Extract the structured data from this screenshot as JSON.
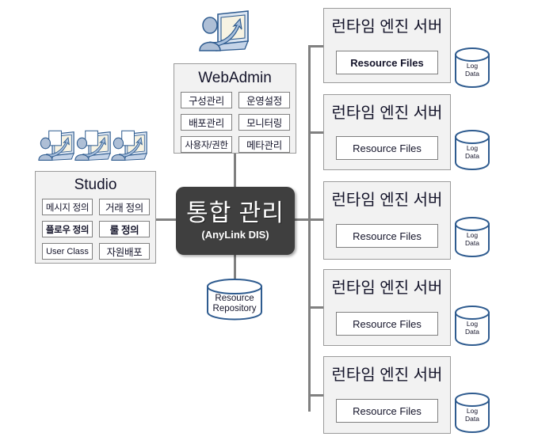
{
  "diagram": {
    "title": "AnyLink DIS architecture diagram",
    "colors": {
      "panel_fill": "#f2f2f2",
      "panel_border": "#9a9a9a",
      "connector": "#808080",
      "hub_fill": "#3f3f3f",
      "hub_text": "#ffffff",
      "cylinder_stroke": "#2e5b8f",
      "text": "#14142a"
    }
  },
  "hub": {
    "name": "integration-management",
    "title": "통합 관리",
    "subtitle": "(AnyLink DIS)"
  },
  "webadmin": {
    "title": "WebAdmin",
    "buttons": [
      {
        "label": "구성관리",
        "bold": false
      },
      {
        "label": "운영설정",
        "bold": false
      },
      {
        "label": "배포관리",
        "bold": false
      },
      {
        "label": "모니터링",
        "bold": false
      },
      {
        "label": "사용자/권한",
        "bold": false
      },
      {
        "label": "메타관리",
        "bold": false
      }
    ],
    "icon": "user-at-computer-icon"
  },
  "studio": {
    "title": "Studio",
    "buttons": [
      {
        "label": "메시지 정의",
        "bold": false
      },
      {
        "label": "거래 정의",
        "bold": false
      },
      {
        "label": "플로우 정의",
        "bold": true
      },
      {
        "label": "룰 정의",
        "bold": true
      },
      {
        "label": "User Class",
        "bold": false
      },
      {
        "label": "자원배포",
        "bold": false
      }
    ],
    "icons": [
      "user-at-computer-icon",
      "user-at-computer-icon",
      "user-at-computer-icon"
    ]
  },
  "repository": {
    "label_line1": "Resource",
    "label_line2": "Repository"
  },
  "servers": [
    {
      "title": "런타임 엔진 서버",
      "resource_label": "Resource  Files",
      "resource_bold": true,
      "log": {
        "line1": "Log",
        "line2": "Data"
      }
    },
    {
      "title": "런타임 엔진 서버",
      "resource_label": "Resource Files",
      "resource_bold": false,
      "log": {
        "line1": "Log",
        "line2": "Data"
      }
    },
    {
      "title": "런타임 엔진 서버",
      "resource_label": "Resource Files",
      "resource_bold": false,
      "log": {
        "line1": "Log",
        "line2": "Data"
      }
    },
    {
      "title": "런타임 엔진 서버",
      "resource_label": "Resource Files",
      "resource_bold": false,
      "log": {
        "line1": "Log",
        "line2": "Data"
      }
    },
    {
      "title": "런타임 엔진 서버",
      "resource_label": "Resource Files",
      "resource_bold": false,
      "log": {
        "line1": "Log",
        "line2": "Data"
      }
    }
  ]
}
